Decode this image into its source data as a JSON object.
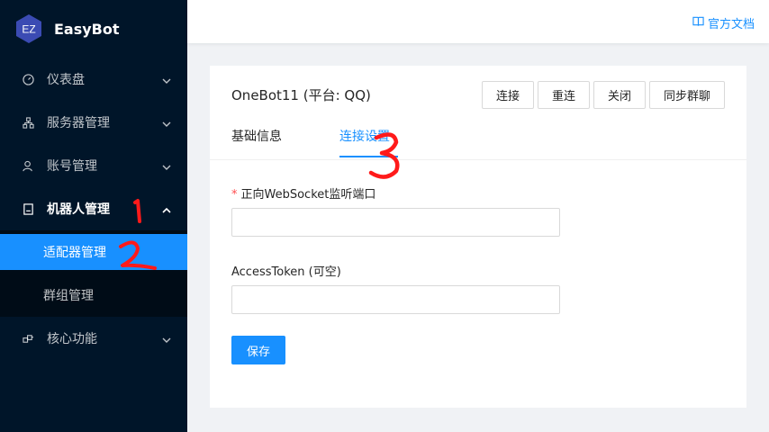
{
  "brand": {
    "logo_text": "EZ",
    "name": "EasyBot"
  },
  "sidebar": {
    "items": [
      {
        "label": "仪表盘",
        "icon": "dashboard-icon"
      },
      {
        "label": "服务器管理",
        "icon": "cluster-icon"
      },
      {
        "label": "账号管理",
        "icon": "user-icon"
      },
      {
        "label": "机器人管理",
        "icon": "robot-icon"
      },
      {
        "label": "核心功能",
        "icon": "core-icon"
      }
    ],
    "subitems": [
      {
        "label": "适配器管理",
        "active": true
      },
      {
        "label": "群组管理",
        "active": false
      }
    ]
  },
  "header": {
    "doc_link": "官方文档",
    "doc_icon": "book-icon"
  },
  "card": {
    "title": "OneBot11 (平台: QQ)",
    "buttons": [
      "连接",
      "重连",
      "关闭",
      "同步群聊"
    ],
    "tabs": [
      {
        "label": "基础信息",
        "active": false
      },
      {
        "label": "连接设置",
        "active": true
      }
    ]
  },
  "form": {
    "port_required_mark": "*",
    "port_label": "正向WebSocket监听端口",
    "port_value": "",
    "token_label": "AccessToken (可空)",
    "token_value": "",
    "save_label": "保存"
  },
  "annotations": [
    "1",
    "2",
    "3"
  ],
  "colors": {
    "sidebar_bg": "#001529",
    "submenu_bg": "#000c17",
    "primary": "#1890ff",
    "annotation": "#ff1a1a"
  }
}
